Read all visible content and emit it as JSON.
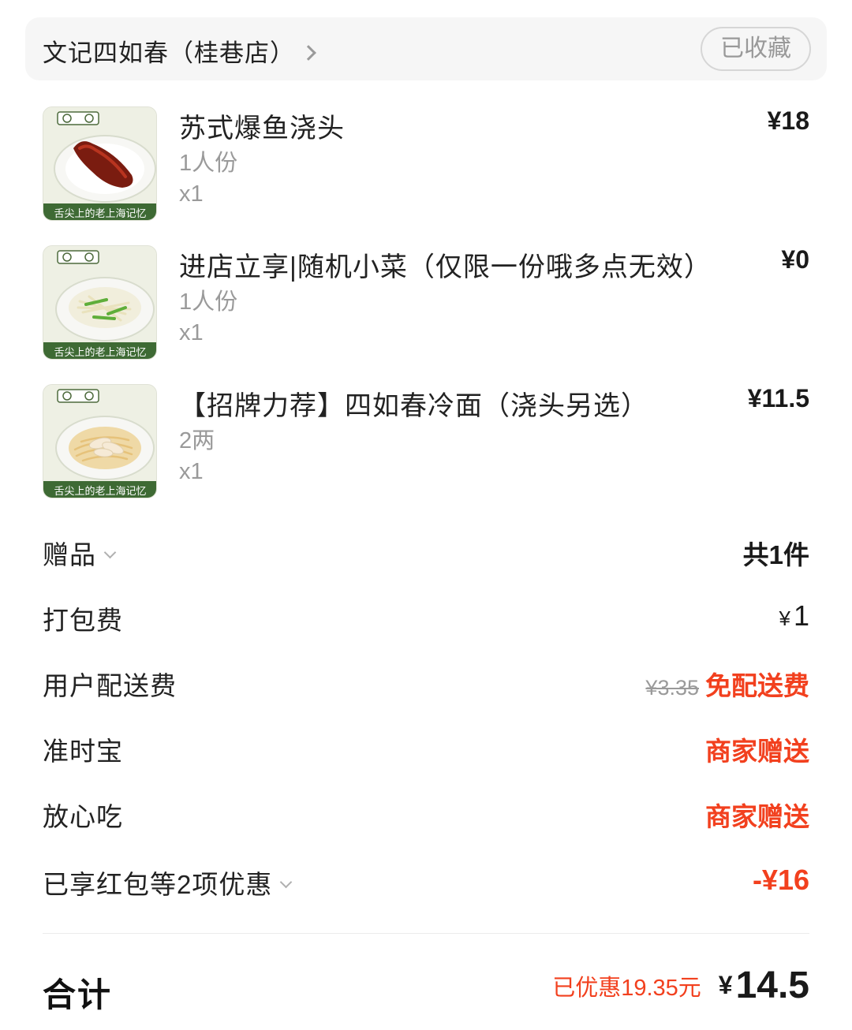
{
  "shop": {
    "name": "文记四如春（桂巷店）",
    "favorite_label": "已收藏"
  },
  "items": [
    {
      "name": "苏式爆鱼浇头",
      "spec": "1人份",
      "qty": "x1",
      "price": "¥18",
      "thumb_caption": "舌尖上的老上海记忆",
      "thumb_food": "fried-fish"
    },
    {
      "name": "进店立享|随机小菜（仅限一份哦多点无效）",
      "spec": "1人份",
      "qty": "x1",
      "price": "¥0",
      "thumb_caption": "舌尖上的老上海记忆",
      "thumb_food": "bean-sprouts"
    },
    {
      "name": "【招牌力荐】四如春冷面（浇头另选）",
      "spec": "2两",
      "qty": "x1",
      "price": "¥11.5",
      "thumb_caption": "舌尖上的老上海记忆",
      "thumb_food": "cold-noodles"
    }
  ],
  "fees": {
    "gift": {
      "label": "赠品",
      "value": "共1件"
    },
    "packing": {
      "label": "打包费",
      "currency": "¥",
      "value": "1"
    },
    "delivery": {
      "label": "用户配送费",
      "original": "¥3.35",
      "value": "免配送费"
    },
    "ontime": {
      "label": "准时宝",
      "value": "商家赠送"
    },
    "safe": {
      "label": "放心吃",
      "value": "商家赠送"
    },
    "discount": {
      "label": "已享红包等2项优惠",
      "value": "-¥16"
    }
  },
  "total": {
    "label": "合计",
    "saved": "已优惠19.35元",
    "currency": "¥",
    "amount": "14.5"
  },
  "colors": {
    "accent_red": "#f2401e",
    "muted": "#9a9a9a"
  }
}
